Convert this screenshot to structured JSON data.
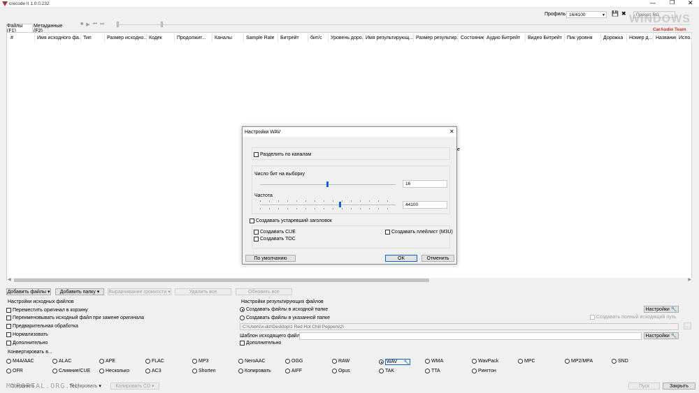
{
  "titlebar": {
    "title": "crecode II 1.0.0.232"
  },
  "tabs": [
    "Файлы (F1)",
    "Метаданные (F2)"
  ],
  "profile": {
    "label": "Профиль",
    "value": "16/4100",
    "right_value": "Пресет RG"
  },
  "watermark": {
    "main": "WINDOWS",
    "sub": "CarAudio Team"
  },
  "columns": [
    "#",
    "Имя исходного фа...",
    "Тип",
    "Размер исходно...",
    "Кодек",
    "Продолжит...",
    "Каналы",
    "Sample Rate",
    "Битрейт",
    "бит/с",
    "Уровень доро...",
    "Имя результирующ...",
    "Размер результир...",
    "Состояние",
    "Аудио Битрейт",
    "Видео Битрейт",
    "Пик уровня",
    "Дорожка",
    "Номер д...",
    "Название",
    "Испо..."
  ],
  "status_hidden_text": "е",
  "buttons_row": {
    "add_files": "Добавить файлы",
    "add_folder": "Добавить папку",
    "volume": "Выравнивание громкости",
    "delete_all": "Удалить все",
    "refresh_all": "Обновить все"
  },
  "source_settings": {
    "title": "Настройки исходных файлов",
    "items": [
      "Переместить оригинал в корзину",
      "Переименовывать исходный файл при замене оригинала",
      "Предварительная обработка",
      "Нормализовать",
      "Дополнительно"
    ]
  },
  "result_settings": {
    "title": "Настройки результирующих файлов",
    "radio_source": "Создавать файлы в исходной папке",
    "radio_custom": "Создавать файлы в указанной папке",
    "settings_button": "Настройки",
    "full_path": "Создавать полный исходящий путь",
    "path_value": "C:\\Users\\x-diz\\Desktop\\1 Red Hot Chili Peppers\\2\\",
    "template_label": "Шаблон исходящего файла:",
    "template_value": "",
    "template_settings": "Настройки",
    "extra": "Дополнительно"
  },
  "convert": {
    "title": "Конвертировать в...",
    "row1": [
      "M4A/AAC",
      "ALAC",
      "APE",
      "FLAC",
      "MP3",
      "NeroAAC",
      "OGG",
      "RAW",
      "WAV",
      "WMA",
      "WavPack",
      "MPC",
      "MP2/MPA",
      "SND"
    ],
    "row2": [
      "OFR",
      "Слияние/CUE",
      "Несколько",
      "AC3",
      "Shorten",
      "Копировать",
      "AIFF",
      "Opus",
      "TAK",
      "TTA",
      "Рингтон"
    ],
    "selected": "WAV"
  },
  "footer": {
    "watermark_text": "MYPORTAL.ORG.RU",
    "save_label": "Сохранить",
    "test_label": "Тестировать",
    "cd_label": "Копировать CD",
    "start": "Пуск",
    "close": "Закрыть"
  },
  "dialog": {
    "title": "Настройки WAV",
    "split_channels": "Разделить по каналам",
    "bits_label": "Число бит на выборку",
    "bits_value": "16",
    "bits_level": 0.49,
    "freq_label": "Частота",
    "freq_value": "44100",
    "freq_level": 0.58,
    "legacy_header": "Создавать устаревший заголовок",
    "create_cue": "Создавать CUE",
    "create_toc": "Создавать TOC",
    "create_playlist": "Создавать плейлист (M3U)",
    "defaults": "По умолчанию",
    "ok": "OK",
    "cancel": "Отменить"
  }
}
